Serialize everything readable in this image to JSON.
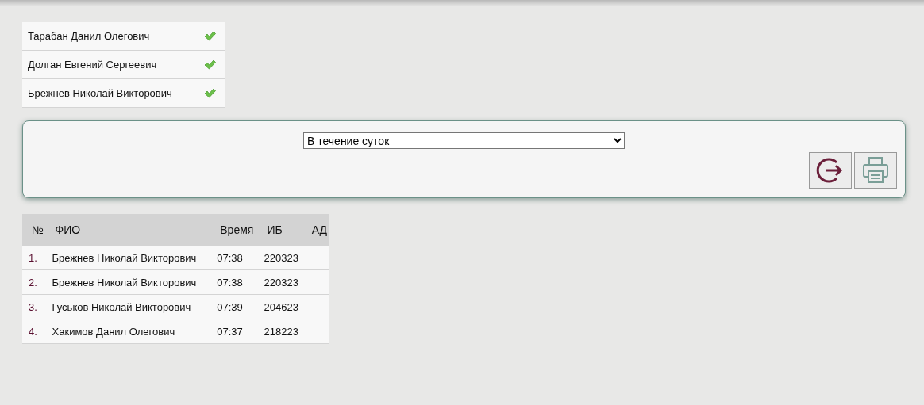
{
  "people": [
    {
      "name": "Тарабан Данил Олегович",
      "checked": true
    },
    {
      "name": "Долган Евгений Сергеевич",
      "checked": true
    },
    {
      "name": "Брежнев Николай Викторович",
      "checked": true
    }
  ],
  "filter": {
    "period": "В течение суток"
  },
  "table": {
    "columns": [
      "№",
      "ФИО",
      "Время",
      "ИБ",
      "АД"
    ],
    "rows": [
      [
        "1.",
        "Брежнев Николай Викторович",
        "07:38",
        "220323",
        ""
      ],
      [
        "2.",
        "Брежнев Николай Викторович",
        "07:38",
        "220323",
        ""
      ],
      [
        "3.",
        "Гуськов Николай Викторович",
        "07:39",
        "204623",
        ""
      ],
      [
        "4.",
        "Хакимов Данил Олегович",
        "07:37",
        "218223",
        ""
      ]
    ]
  }
}
